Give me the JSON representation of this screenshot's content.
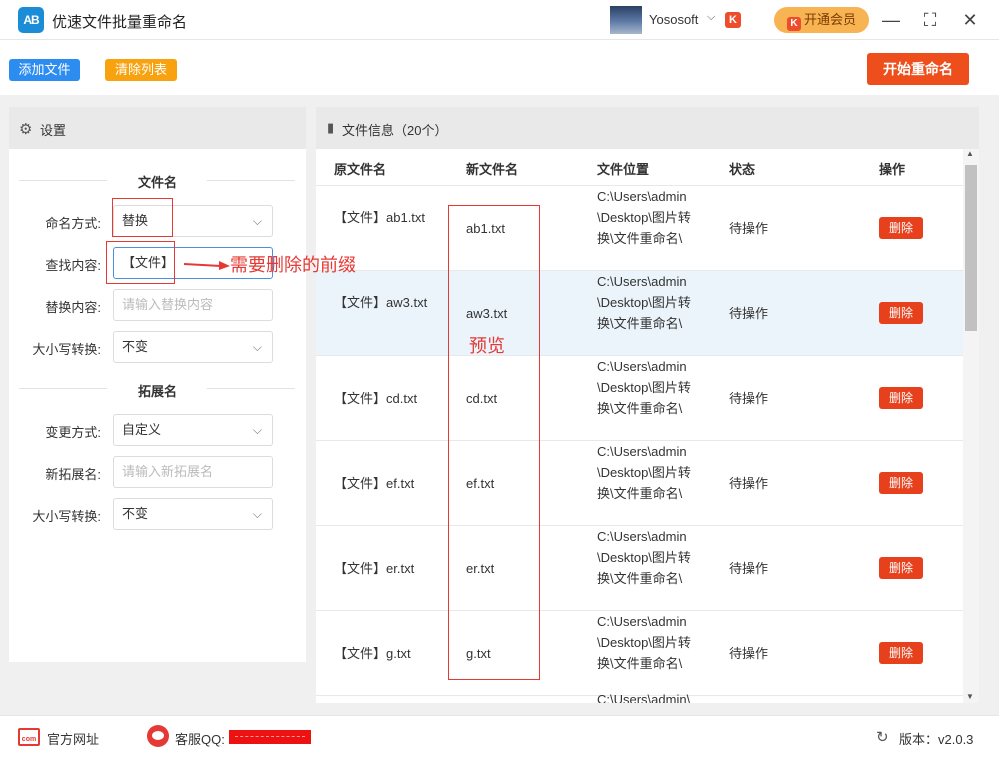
{
  "app": {
    "logo": "AB",
    "title": "优速文件批量重命名"
  },
  "user": {
    "name": "Yososoft",
    "vip_mark": "K",
    "vip_button": "开通会员"
  },
  "window": {
    "minimize": "—",
    "maximize": "⛶",
    "close": "✕"
  },
  "toolbar": {
    "add_files": "添加文件",
    "clear_list": "清除列表",
    "start_rename": "开始重命名"
  },
  "settings": {
    "title": "设置",
    "filename_section": "文件名",
    "naming_mode_label": "命名方式:",
    "naming_mode_value": "替换",
    "find_label": "查找内容:",
    "find_value": "【文件】",
    "replace_label": "替换内容:",
    "replace_placeholder": "请输入替换内容",
    "case_label": "大小写转换:",
    "case_value": "不变",
    "ext_section": "拓展名",
    "ext_mode_label": "变更方式:",
    "ext_mode_value": "自定义",
    "new_ext_label": "新拓展名:",
    "new_ext_placeholder": "请输入新拓展名",
    "ext_case_label": "大小写转换:",
    "ext_case_value": "不变"
  },
  "files": {
    "title": "文件信息（20个）",
    "columns": {
      "original": "原文件名",
      "new": "新文件名",
      "location": "文件位置",
      "status": "状态",
      "action": "操作"
    },
    "rows": [
      {
        "original": "【文件】ab1.txt",
        "new": "ab1.txt",
        "location": "C:\\Users\\admin\\Desktop\\图片转换\\文件重命名\\",
        "status": "待操作",
        "action": "删除"
      },
      {
        "original": "【文件】aw3.txt",
        "new": "aw3.txt",
        "location": "C:\\Users\\admin\\Desktop\\图片转换\\文件重命名\\",
        "status": "待操作",
        "action": "删除"
      },
      {
        "original": "【文件】cd.txt",
        "new": "cd.txt",
        "location": "C:\\Users\\admin\\Desktop\\图片转换\\文件重命名\\",
        "status": "待操作",
        "action": "删除"
      },
      {
        "original": "【文件】ef.txt",
        "new": "ef.txt",
        "location": "C:\\Users\\admin\\Desktop\\图片转换\\文件重命名\\",
        "status": "待操作",
        "action": "删除"
      },
      {
        "original": "【文件】er.txt",
        "new": "er.txt",
        "location": "C:\\Users\\admin\\Desktop\\图片转换\\文件重命名\\",
        "status": "待操作",
        "action": "删除"
      },
      {
        "original": "【文件】g.txt",
        "new": "g.txt",
        "location": "C:\\Users\\admin\\Desktop\\图片转换\\文件重命名\\",
        "status": "待操作",
        "action": "删除"
      },
      {
        "original": "",
        "new": "",
        "location": "C:\\Users\\admin\\",
        "status": "",
        "action": ""
      }
    ]
  },
  "annotations": {
    "prefix_note": "需要删除的前缀",
    "preview_note": "预览"
  },
  "footer": {
    "site": "官方网址",
    "site_icon": "com",
    "support_label": "客服QQ:",
    "version": "版本：v2.0.3"
  },
  "colors": {
    "accent_blue": "#2d8cf0",
    "accent_orange": "#f8a210",
    "start_red": "#ee4d1c",
    "delete_red": "#e6401d",
    "annotation_red": "#e53935"
  }
}
